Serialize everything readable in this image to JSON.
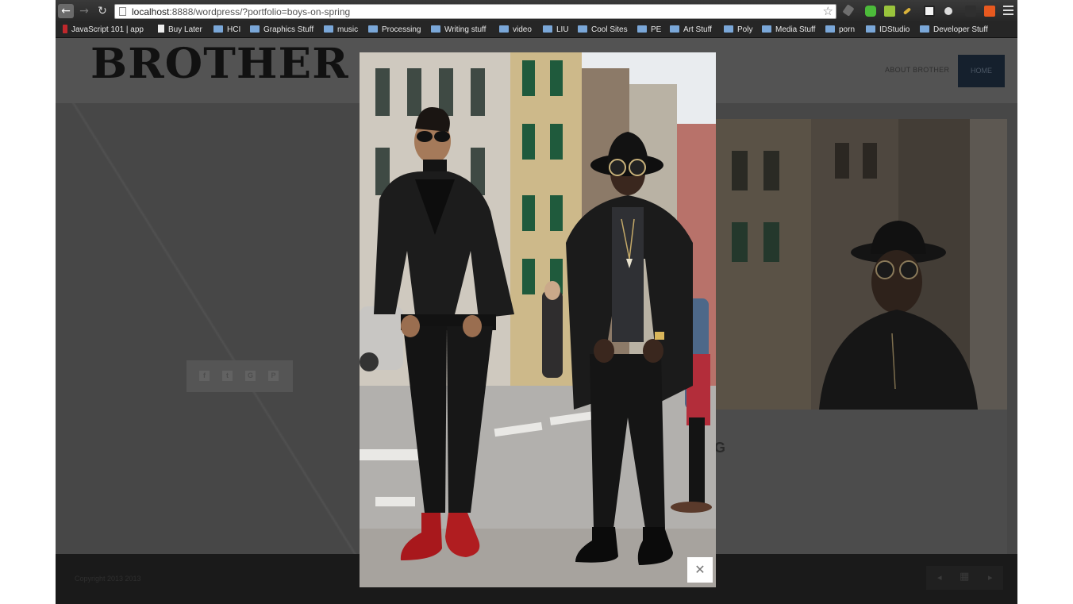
{
  "browser": {
    "url_host": "localhost",
    "url_rest": ":8888/wordpress/?portfolio=boys-on-spring",
    "bookmarks": [
      {
        "label": "JavaScript 101 | app",
        "icon": "js-icon"
      },
      {
        "label": "Buy Later",
        "icon": "page-icon"
      },
      {
        "label": "HCI",
        "icon": "folder-icon"
      },
      {
        "label": "Graphics Stuff",
        "icon": "folder-icon"
      },
      {
        "label": "music",
        "icon": "folder-icon"
      },
      {
        "label": "Processing",
        "icon": "folder-icon"
      },
      {
        "label": "Writing stuff",
        "icon": "folder-icon"
      },
      {
        "label": "video",
        "icon": "folder-icon"
      },
      {
        "label": "LIU",
        "icon": "folder-icon"
      },
      {
        "label": "Cool Sites",
        "icon": "folder-icon"
      },
      {
        "label": "PE",
        "icon": "folder-icon"
      },
      {
        "label": "Art Stuff",
        "icon": "folder-icon"
      },
      {
        "label": "Poly",
        "icon": "folder-icon"
      },
      {
        "label": "Media Stuff",
        "icon": "folder-icon"
      },
      {
        "label": "porn",
        "icon": "folder-icon"
      },
      {
        "label": "IDStudio",
        "icon": "folder-icon"
      },
      {
        "label": "Developer Stuff",
        "icon": "folder-icon"
      }
    ]
  },
  "site": {
    "logo": "BROTHER",
    "nav": {
      "about": "ABOUT BROTHER",
      "home": "HOME"
    },
    "share_icons": [
      "f",
      "t",
      "G",
      "P"
    ],
    "partial_heading": "G",
    "copyright": "Copyright 2013 2013",
    "colors": {
      "nav_home_bg": "#15202d",
      "overlay": "#4b4b4b"
    }
  },
  "lightbox": {
    "close_icon": "close-icon",
    "photo": "photo of two young men standing on a city street, one in a leather jacket with red boots, one in a black hat and round sunglasses"
  }
}
